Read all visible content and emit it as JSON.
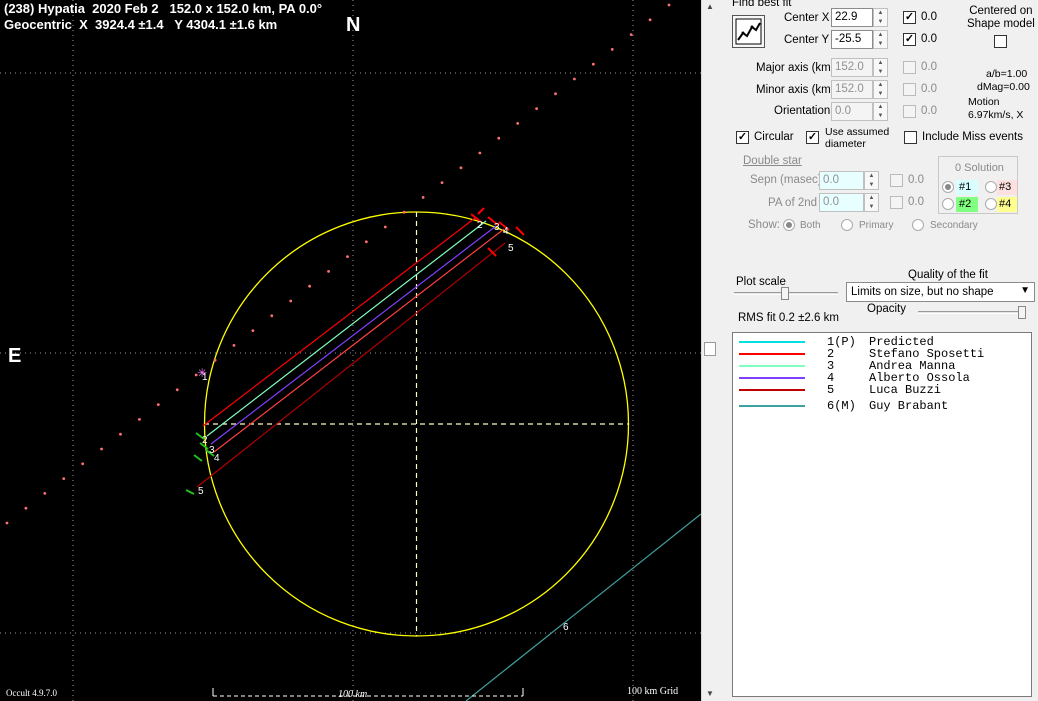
{
  "plot": {
    "title_line1": "(238) Hypatia  2020 Feb 2   152.0 x 152.0 km, PA 0.0°",
    "title_line2": "Geocentric  X  3924.4 ±1.4   Y 4304.1 ±1.6 km",
    "north": "N",
    "east": "E",
    "version": "Occult 4.9.7.0",
    "scale_label": "100 km",
    "grid_label": "100 km Grid",
    "chord_labels": [
      "1",
      "2",
      "3",
      "4",
      "5",
      "6"
    ],
    "colors": {
      "ellipse": "#ffff00",
      "predicted": "#00e0e0",
      "sposetti": "#ff0000",
      "manna": "#80ffc0",
      "ossola": "#8040ff",
      "buzzi": "#ff3030",
      "brabant": "#40a0a0",
      "path_dots": "#ff7070"
    }
  },
  "panel": {
    "find_best_fit": "Find best fit",
    "center_x_label": "Center X",
    "center_x_value": "22.9",
    "center_x_unc": "0.0",
    "center_y_label": "Center Y",
    "center_y_value": "-25.5",
    "center_y_unc": "0.0",
    "centered_on_shape": "Centered on\nShape model",
    "major_label": "Major axis (km)",
    "major_value": "152.0",
    "major_unc": "0.0",
    "minor_label": "Minor axis (km)",
    "minor_value": "152.0",
    "minor_unc": "0.0",
    "orientation_label": "Orientation",
    "orientation_value": "0.0",
    "orientation_unc": "0.0",
    "ab_ratio": "a/b=1.00",
    "dmag": "dMag=0.00",
    "motion_label": "Motion",
    "motion_value": "6.97km/s, X",
    "circular_label": "Circular",
    "assumed_diameter_label": "Use assumed\ndiameter",
    "include_miss_label": "Include Miss events",
    "double_star": "Double star",
    "sepn_label": "Sepn (masec)",
    "sepn_value": "0.0",
    "sepn_unc": "0.0",
    "pa2_label": "PA of 2nd",
    "pa2_value": "0.0",
    "pa2_unc": "0.0",
    "solution_title": "0 Solution",
    "sol1": "#1",
    "sol2": "#2",
    "sol3": "#3",
    "sol4": "#4",
    "show_label": "Show:",
    "show_both": "Both",
    "show_primary": "Primary",
    "show_secondary": "Secondary",
    "plot_scale": "Plot scale",
    "quality_label": "Quality of the fit",
    "quality_value": "Limits on size, but no shape",
    "opacity_label": "Opacity",
    "rms_fit": "RMS fit 0.2 ±2.6 km"
  },
  "legend": [
    {
      "index": "1(P)",
      "name": "Predicted",
      "color": "#00e0e0"
    },
    {
      "index": "2",
      "name": "Stefano Sposetti",
      "color": "#ff0000"
    },
    {
      "index": "3",
      "name": "Andrea Manna",
      "color": "#80ffc0"
    },
    {
      "index": "4",
      "name": "Alberto Ossola",
      "color": "#8040ff"
    },
    {
      "index": "5",
      "name": "Luca Buzzi",
      "color": "#c00000"
    },
    {
      "index": "6(M)",
      "name": "Guy Brabant",
      "color": "#40a0a0"
    }
  ]
}
